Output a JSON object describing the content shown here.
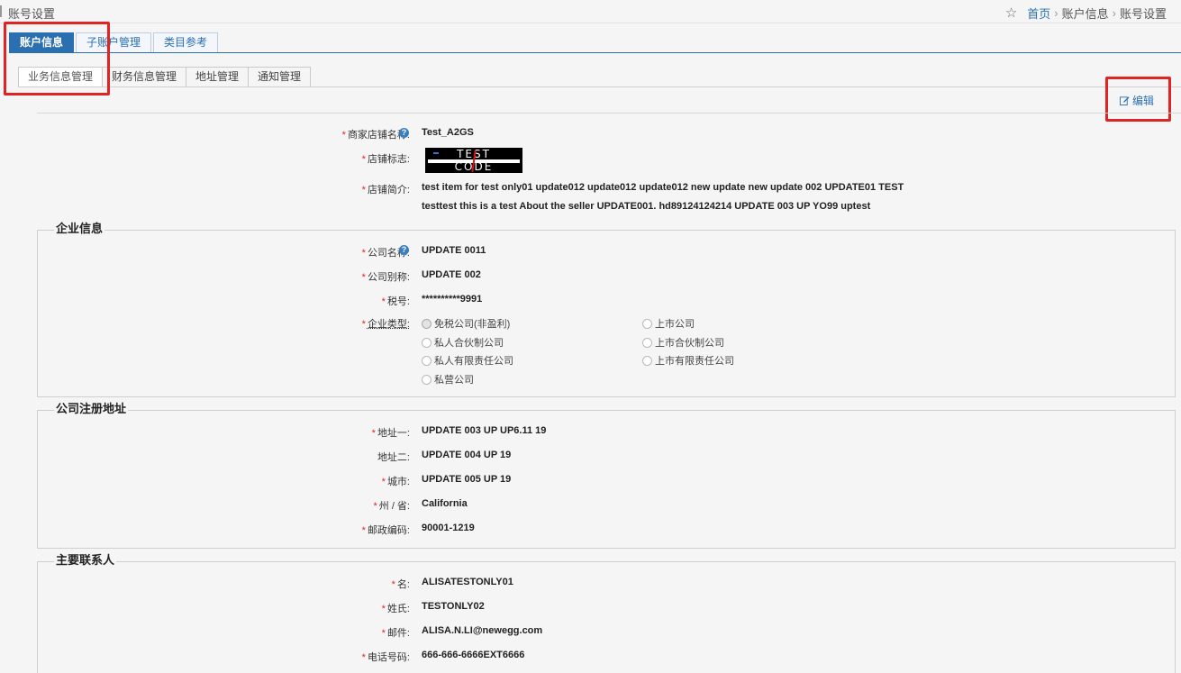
{
  "header": {
    "page_title": "账号设置",
    "breadcrumb": [
      "首页",
      "账户信息",
      "账号设置"
    ],
    "breadcrumb_sep": "›"
  },
  "primary_tabs": [
    "账户信息",
    "子账户管理",
    "类目参考"
  ],
  "secondary_tabs": [
    "业务信息管理",
    "财务信息管理",
    "地址管理",
    "通知管理"
  ],
  "edit_label": "编辑",
  "store": {
    "name_label": "商家店铺名称:",
    "name_value": "Test_A2GS",
    "logo_label": "店铺标志:",
    "logo_text_top": "TEST",
    "logo_text_bottom": "CODE",
    "intro_label": "店铺简介:",
    "intro_line1": "test item for test only01 update012 update012 update012 new update new update 002 UPDATE01 TEST",
    "intro_line2": "testtest this is a test About the seller UPDATE001. hd89124124214 UPDATE 003 UP YO99 uptest"
  },
  "company": {
    "title": "企业信息",
    "name_label": "公司名称:",
    "name_value": "UPDATE 0011",
    "alias_label": "公司别称:",
    "alias_value": "UPDATE 002",
    "tax_label": "税号:",
    "tax_value": "**********9991",
    "type_label": "企业类型:",
    "types": [
      {
        "label": "免税公司(非盈利)",
        "checked": true
      },
      {
        "label": "上市公司",
        "checked": false
      },
      {
        "label": "私人合伙制公司",
        "checked": false
      },
      {
        "label": "上市合伙制公司",
        "checked": false
      },
      {
        "label": "私人有限责任公司",
        "checked": false
      },
      {
        "label": "上市有限责任公司",
        "checked": false
      },
      {
        "label": "私营公司",
        "checked": false
      }
    ]
  },
  "address": {
    "title": "公司注册地址",
    "addr1_label": "地址一:",
    "addr1_value": "UPDATE 003 UP UP6.11 19",
    "addr2_label": "地址二:",
    "addr2_value": "UPDATE 004 UP 19",
    "city_label": "城市:",
    "city_value": "UPDATE 005 UP 19",
    "state_label": "州 / 省:",
    "state_value": "California",
    "zip_label": "邮政编码:",
    "zip_value": "90001-1219"
  },
  "contact": {
    "title": "主要联系人",
    "first_label": "名:",
    "first_value": "ALISATESTONLY01",
    "last_label": "姓氏:",
    "last_value": "TESTONLY02",
    "email_label": "邮件:",
    "email_value": "ALISA.N.LI@newegg.com",
    "phone_label": "电话号码:",
    "phone_value": "666-666-6666EXT6666"
  },
  "colors": {
    "accent": "#2a6fb0",
    "highlight": "#e02323",
    "required": "#e02323"
  }
}
